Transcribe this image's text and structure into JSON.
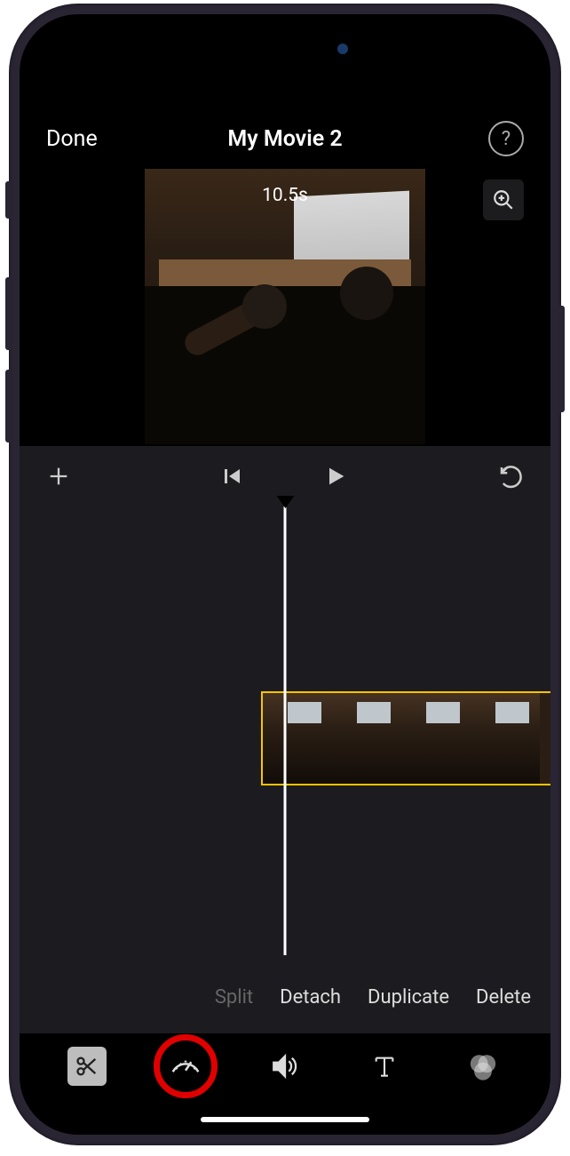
{
  "header": {
    "done_label": "Done",
    "title": "My Movie 2",
    "help_label": "?"
  },
  "preview": {
    "duration": "10.5s"
  },
  "actions": {
    "split": "Split",
    "detach": "Detach",
    "duplicate": "Duplicate",
    "delete": "Delete"
  },
  "tools": {
    "scissors": "scissors-icon",
    "speed": "speedometer-icon",
    "volume": "speaker-icon",
    "text": "text-icon",
    "filters": "filters-icon"
  },
  "colors": {
    "accent": "#f8c400",
    "highlight": "#e00000"
  }
}
